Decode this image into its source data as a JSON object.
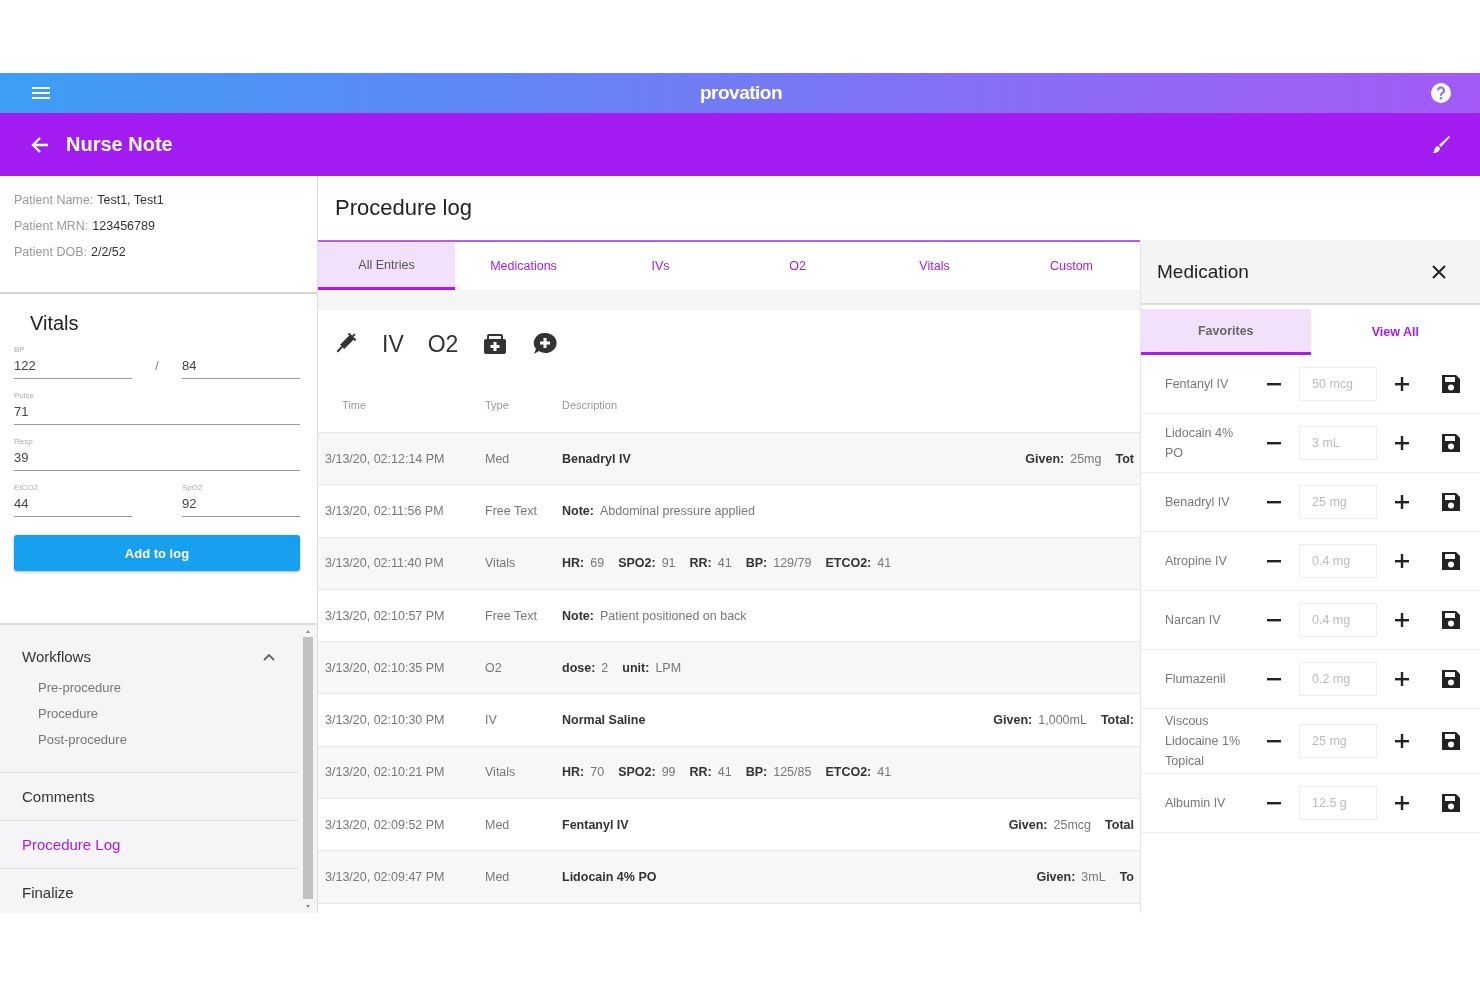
{
  "top_bar": {
    "logo": "provation"
  },
  "header": {
    "title": "Nurse Note"
  },
  "patient": [
    {
      "label": "Patient Name:",
      "value": "Test1, Test1"
    },
    {
      "label": "Patient MRN:",
      "value": "123456789"
    },
    {
      "label": "Patient DOB:",
      "value": "2/2/52"
    }
  ],
  "vitals": {
    "title": "Vitals",
    "rows": [
      {
        "separator": "/",
        "fields": [
          {
            "label": "BP",
            "value": "122"
          },
          {
            "value": "84"
          }
        ]
      },
      {
        "fields": [
          {
            "label": "Pulse",
            "value": "71"
          }
        ]
      },
      {
        "fields": [
          {
            "label": "Resp",
            "value": "39"
          }
        ]
      },
      {
        "fields": [
          {
            "label": "EtCO2",
            "value": "44"
          },
          {
            "label": "SpO2",
            "value": "92"
          }
        ]
      }
    ],
    "button": "Add to log"
  },
  "nav": [
    {
      "label": "Workflows",
      "expanded": true,
      "selected": false,
      "children": [
        {
          "label": "Pre-procedure"
        },
        {
          "label": "Procedure"
        },
        {
          "label": "Post-procedure"
        }
      ]
    },
    {
      "label": "Comments",
      "selected": false
    },
    {
      "label": "Procedure Log",
      "selected": true
    },
    {
      "label": "Finalize",
      "selected": false
    }
  ],
  "main": {
    "title": "Procedure log",
    "tabs": [
      {
        "label": "All Entries",
        "selected": true
      },
      {
        "label": "Medications",
        "selected": false
      },
      {
        "label": "IVs",
        "selected": false
      },
      {
        "label": "O2",
        "selected": false
      },
      {
        "label": "Vitals",
        "selected": false
      },
      {
        "label": "Custom",
        "selected": false
      }
    ],
    "toolbar": [
      {
        "kind": "icon"
      },
      {
        "kind": "text",
        "label": "IV"
      },
      {
        "kind": "text",
        "label": "O2"
      },
      {
        "kind": "icon"
      },
      {
        "kind": "icon"
      }
    ],
    "table": {
      "columns": [
        "Time",
        "Type",
        "Description"
      ],
      "rows": [
        {
          "time": "3/13/20, 02:12:14 PM",
          "type": "Med",
          "name": "Benadryl IV",
          "details": [],
          "right": [
            {
              "label": "Given:",
              "value": "25mg"
            },
            {
              "label": "Tot"
            }
          ]
        },
        {
          "time": "3/13/20, 02:11:56 PM",
          "type": "Free Text",
          "details": [
            {
              "label": "Note:",
              "value": "Abdominal pressure applied"
            }
          ]
        },
        {
          "time": "3/13/20, 02:11:40 PM",
          "type": "Vitals",
          "details": [
            {
              "label": "HR:",
              "value": "69"
            },
            {
              "label": "SPO2:",
              "value": "91"
            },
            {
              "label": "RR:",
              "value": "41"
            },
            {
              "label": "BP:",
              "value": "129/79"
            },
            {
              "label": "ETCO2:",
              "value": "41"
            }
          ]
        },
        {
          "time": "3/13/20, 02:10:57 PM",
          "type": "Free Text",
          "details": [
            {
              "label": "Note:",
              "value": "Patient positioned on back"
            }
          ]
        },
        {
          "time": "3/13/20, 02:10:35 PM",
          "type": "O2",
          "details": [
            {
              "label": "dose:",
              "value": "2"
            },
            {
              "label": "unit:",
              "value": "LPM"
            }
          ]
        },
        {
          "time": "3/13/20, 02:10:30 PM",
          "type": "IV",
          "name": "Normal Saline",
          "details": [],
          "right": [
            {
              "label": "Given:",
              "value": "1,000mL"
            },
            {
              "label": "Total:"
            }
          ]
        },
        {
          "time": "3/13/20, 02:10:21 PM",
          "type": "Vitals",
          "details": [
            {
              "label": "HR:",
              "value": "70"
            },
            {
              "label": "SPO2:",
              "value": "99"
            },
            {
              "label": "RR:",
              "value": "41"
            },
            {
              "label": "BP:",
              "value": "125/85"
            },
            {
              "label": "ETCO2:",
              "value": "41"
            }
          ]
        },
        {
          "time": "3/13/20, 02:09:52 PM",
          "type": "Med",
          "name": "Fentanyl IV",
          "details": [],
          "right": [
            {
              "label": "Given:",
              "value": "25mcg"
            },
            {
              "label": "Total"
            }
          ]
        },
        {
          "time": "3/13/20, 02:09:47 PM",
          "type": "Med",
          "name": "Lidocain 4% PO",
          "details": [],
          "right": [
            {
              "label": "Given:",
              "value": "3mL"
            },
            {
              "label": "To"
            }
          ]
        }
      ]
    }
  },
  "medication": {
    "title": "Medication",
    "tabs": [
      {
        "label": "Favorites",
        "selected": true
      },
      {
        "label": "View All",
        "selected": false
      }
    ],
    "items": [
      {
        "name": "Fentanyl IV",
        "dose": "50 mcg"
      },
      {
        "name": "Lidocain 4% PO",
        "dose": "3 mL"
      },
      {
        "name": "Benadryl IV",
        "dose": "25 mg"
      },
      {
        "name": "Atropine IV",
        "dose": "0.4 mg"
      },
      {
        "name": "Narcan IV",
        "dose": "0.4 mg"
      },
      {
        "name": "Flumazenil",
        "dose": "0.2 mg"
      },
      {
        "name": "Viscous Lidocaine 1% Topical",
        "dose": "25 mg"
      },
      {
        "name": "Albumin IV",
        "dose": "12.5 g"
      }
    ]
  }
}
